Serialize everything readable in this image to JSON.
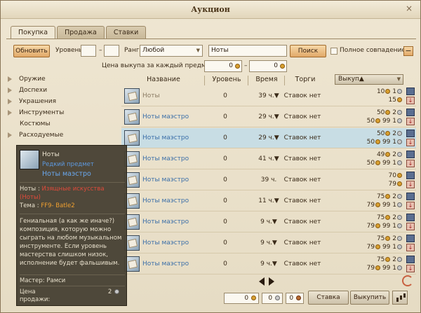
{
  "window": {
    "title": "Аукцион"
  },
  "tabs": [
    {
      "label": "Покупка",
      "active": true
    },
    {
      "label": "Продажа",
      "active": false
    },
    {
      "label": "Ставки",
      "active": false
    }
  ],
  "toolbar": {
    "refresh_label": "Обновить",
    "level_label": "Уровень",
    "level_from": "",
    "level_dash": "–",
    "level_to": "",
    "rank_label": "Ранг",
    "rank_value": "Любой",
    "search_value": "Ноты",
    "search_button": "Поиск",
    "exact_match_label": "Полное совпадение",
    "collapse_label": "−"
  },
  "buyout_filter": {
    "label": "Цена выкупа за каждый предмет лота",
    "from": "0",
    "dash": "–",
    "to": "0"
  },
  "sidebar": {
    "items": [
      {
        "label": "Оружие",
        "has_arrow": true
      },
      {
        "label": "Доспехи",
        "has_arrow": true
      },
      {
        "label": "Украшения",
        "has_arrow": true
      },
      {
        "label": "Инструменты",
        "has_arrow": true
      },
      {
        "label": "Костюмы",
        "has_arrow": false
      },
      {
        "label": "Расходуемые",
        "has_arrow": true
      }
    ]
  },
  "columns": {
    "name": "Название",
    "level": "Уровень",
    "time": "Время",
    "bids": "Торги",
    "sort": "Выкуп▲"
  },
  "rows": [
    {
      "name": "Ноты",
      "gray": true,
      "level": "0",
      "time": "39 ч.▼",
      "bids": "Ставок нет",
      "p1": "10",
      "p1c": "1",
      "p2": "15",
      "p2c": ""
    },
    {
      "name": "Ноты маэстро",
      "gray": false,
      "level": "0",
      "time": "29 ч.▼",
      "bids": "Ставок нет",
      "p1": "50",
      "p1c": "2",
      "p2": "50",
      "p2c": "99 1"
    },
    {
      "name": "Ноты маэстро",
      "gray": false,
      "level": "0",
      "time": "29 ч.▼",
      "bids": "Ставок нет",
      "p1": "50",
      "p1c": "2",
      "p2": "50",
      "p2c": "99 1",
      "selected": true
    },
    {
      "name": "Ноты маэстро",
      "gray": false,
      "level": "0",
      "time": "41 ч.▼",
      "bids": "Ставок нет",
      "p1": "49",
      "p1c": "2",
      "p2": "50",
      "p2c": "99 1"
    },
    {
      "name": "Ноты маэстро",
      "gray": false,
      "level": "0",
      "time": "39 ч.",
      "bids": "Ставок нет",
      "p1": "70",
      "p1c": "",
      "p2": "79",
      "p2c": ""
    },
    {
      "name": "Ноты маэстро",
      "gray": false,
      "level": "0",
      "time": "11 ч.▼",
      "bids": "Ставок нет",
      "p1": "75",
      "p1c": "2",
      "p2": "79",
      "p2c": "99 1"
    },
    {
      "name": "Ноты маэстро",
      "gray": false,
      "level": "0",
      "time": "9 ч.▼",
      "bids": "Ставок нет",
      "p1": "75",
      "p1c": "2",
      "p2": "79",
      "p2c": "99 1"
    },
    {
      "name": "Ноты маэстро",
      "gray": false,
      "level": "0",
      "time": "9 ч.▼",
      "bids": "Ставок нет",
      "p1": "75",
      "p1c": "2",
      "p2": "79",
      "p2c": "99 1"
    },
    {
      "name": "Ноты маэстро",
      "gray": false,
      "level": "0",
      "time": "9 ч.▼",
      "bids": "Ставок нет",
      "p1": "75",
      "p1c": "2",
      "p2": "79",
      "p2c": "99 1"
    }
  ],
  "tooltip": {
    "title": "Ноты",
    "rarity": "Редкий предмет",
    "name": "Ноты маэстро",
    "category_prefix": "Ноты : ",
    "category_value": "Изящные искусства",
    "category_line2": "(Ноты)",
    "theme_prefix": "Тема : ",
    "theme_value": "FF9- Batle2",
    "description": "Гениальная (а как же иначе?) композиция, которую можно сыграть на любом музыкальном инструменте. Если уровень мастерства слишком низок, исполнение будет фальшивым.",
    "master_label": "Мастер:",
    "master_value": "Рамси",
    "price_label": "Цена продажи:",
    "price_value": "2"
  },
  "bottom": {
    "gold": "0",
    "silver": "0",
    "copper": "0",
    "bid_button": "Ставка",
    "buyout_button": "Выкупить"
  }
}
